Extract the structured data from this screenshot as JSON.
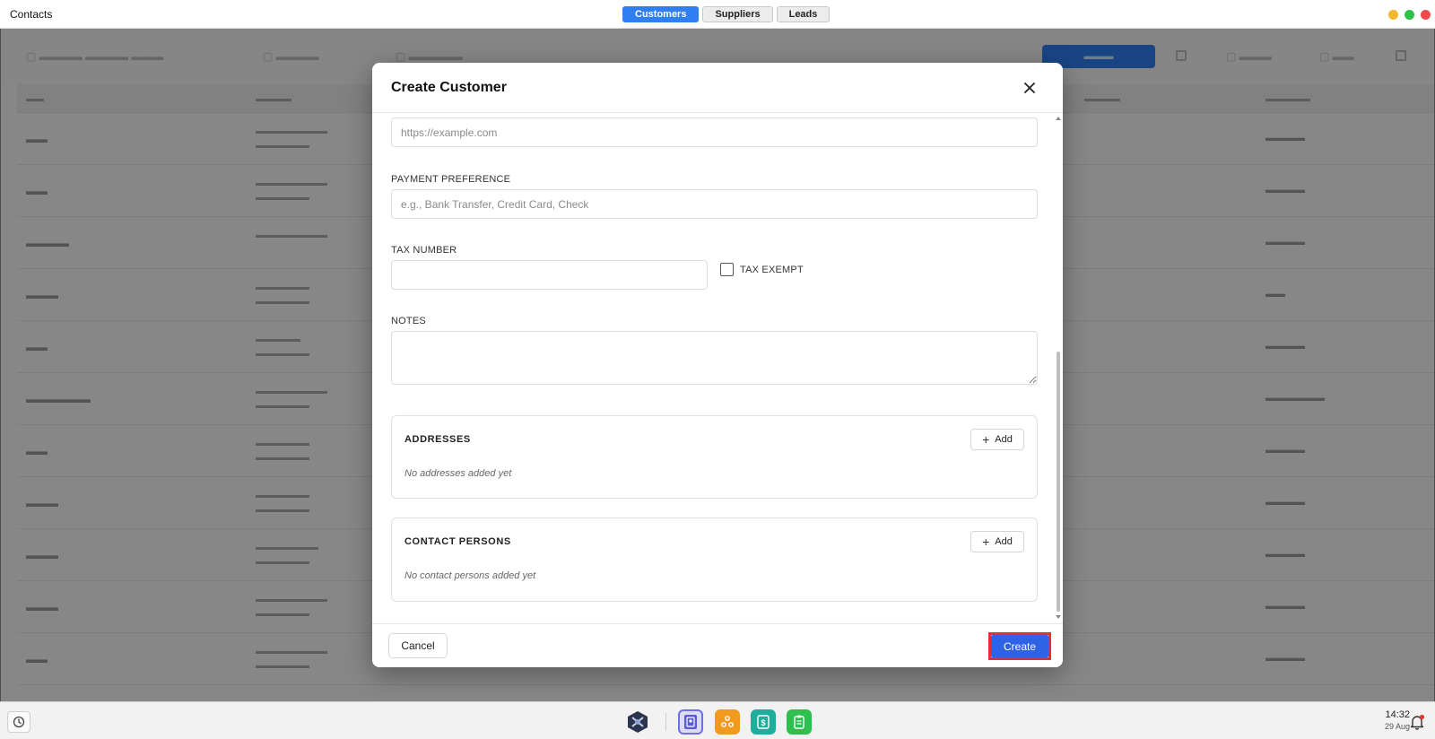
{
  "window": {
    "title": "Contacts",
    "tabs": [
      {
        "label": "Customers",
        "active": true
      },
      {
        "label": "Suppliers",
        "active": false
      },
      {
        "label": "Leads",
        "active": false
      }
    ]
  },
  "modal": {
    "title": "Create Customer",
    "website": {
      "value": "",
      "placeholder": "https://example.com"
    },
    "payment_preference": {
      "label": "PAYMENT PREFERENCE",
      "value": "",
      "placeholder": "e.g., Bank Transfer, Credit Card, Check"
    },
    "tax_number": {
      "label": "TAX NUMBER",
      "value": ""
    },
    "tax_exempt": {
      "label": "TAX EXEMPT",
      "checked": false
    },
    "notes": {
      "label": "NOTES",
      "value": ""
    },
    "addresses": {
      "title": "ADDRESSES",
      "add_label": "Add",
      "empty": "No addresses added yet"
    },
    "contact_persons": {
      "title": "CONTACT PERSONS",
      "add_label": "Add",
      "empty": "No contact persons added yet"
    },
    "cancel_label": "Cancel",
    "create_label": "Create"
  },
  "taskbar": {
    "time": "14:32",
    "date": "29 Aug"
  },
  "colors": {
    "accent": "#2f7ff2",
    "create_button": "#2f63e6",
    "highlight": "#e03030",
    "notification_dot": "#e53935"
  }
}
